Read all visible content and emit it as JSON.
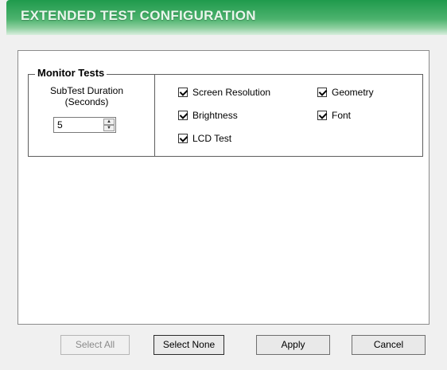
{
  "header": {
    "title": "EXTENDED TEST CONFIGURATION"
  },
  "monitor_tests": {
    "legend": "Monitor Tests",
    "duration_label_line1": "SubTest Duration",
    "duration_label_line2": "(Seconds)",
    "duration_value": "5",
    "tests": [
      {
        "label": "Screen Resolution",
        "checked": true
      },
      {
        "label": "Geometry",
        "checked": true
      },
      {
        "label": "Brightness",
        "checked": true
      },
      {
        "label": "Font",
        "checked": true
      },
      {
        "label": "LCD Test",
        "checked": true
      }
    ]
  },
  "buttons": {
    "select_all": "Select All",
    "select_none": "Select None",
    "apply": "Apply",
    "cancel": "Cancel"
  },
  "colors": {
    "header_green": "#1f9a4c"
  }
}
